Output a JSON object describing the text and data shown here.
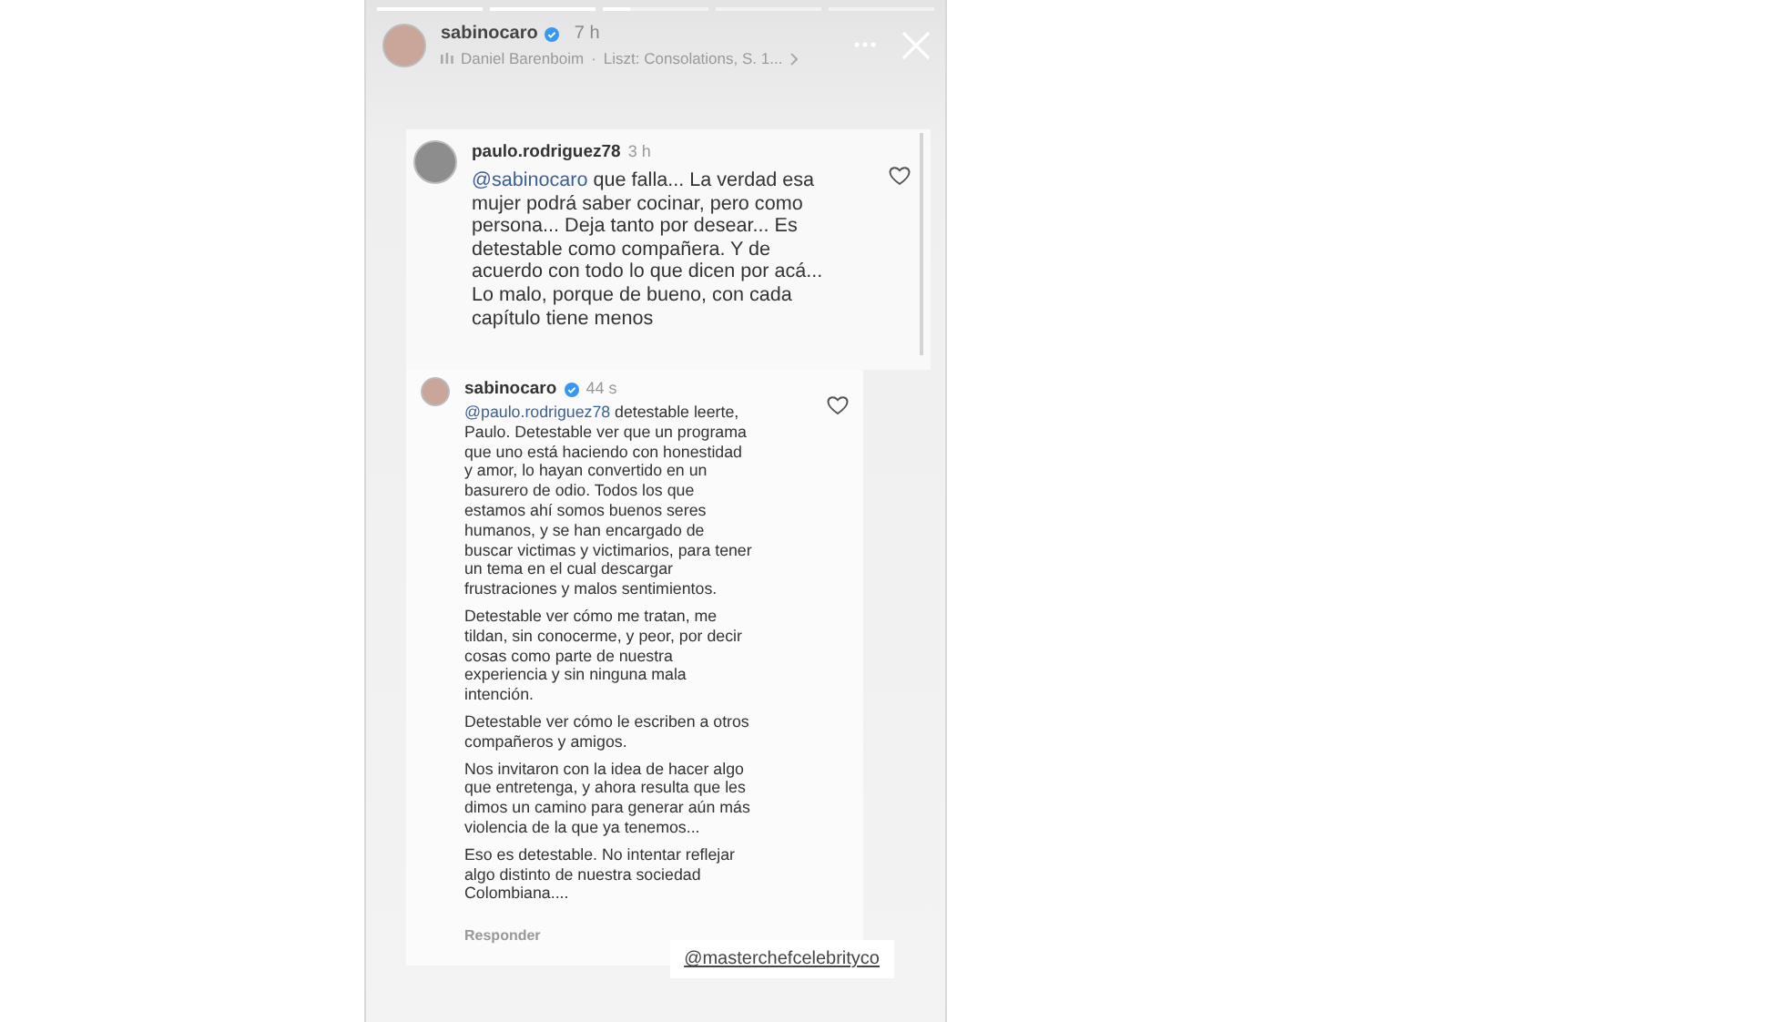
{
  "story": {
    "progress": [
      {
        "level": 1
      },
      {
        "level": 1
      },
      {
        "level": 0.25
      },
      {
        "level": 0
      },
      {
        "level": 0
      }
    ],
    "author": "sabinocaro",
    "verified": true,
    "time": "7 h",
    "music": {
      "artist": "Daniel Barenboim",
      "separator": "·",
      "track": "Liszt: Consolations, S. 1..."
    }
  },
  "comment": {
    "author": "paulo.rodriguez78",
    "time": "3 h",
    "mention": "@sabinocaro",
    "text": " que falla... La verdad esa mujer podrá saber cocinar, pero como persona... Deja tanto por desear... Es detestable como compañera. Y de acuerdo con todo lo que dicen por acá... Lo malo, porque de bueno, con cada capítulo tiene menos",
    "liked": false
  },
  "reply": {
    "author": "sabinocaro",
    "verified": true,
    "time": "44 s",
    "mention": "@paulo.rodriguez78",
    "liked": false,
    "paragraphs": [
      " detestable leerte, Paulo. Detestable ver que un programa que uno está haciendo con honestidad y amor, lo hayan convertido en un basurero de odio. Todos los que estamos ahí somos buenos seres humanos, y se han encargado de buscar victimas y victimarios, para tener un tema en el cual descargar frustraciones y malos sentimientos.",
      "Detestable ver cómo me tratan, me tildan, sin conocerme, y peor, por decir cosas como parte de nuestra experiencia y sin ninguna mala intención.",
      "Detestable ver cómo le escriben a otros compañeros y amigos.",
      "Nos invitaron con la idea de hacer algo que entretenga, y ahora resulta que les dimos un camino para generar aún más violencia de la que ya tenemos...",
      "Eso es detestable. No intentar reflejar algo distinto de nuestra sociedad Colombiana...."
    ],
    "reply_label": "Responder"
  },
  "sticker": "@masterchefcelebrityco"
}
